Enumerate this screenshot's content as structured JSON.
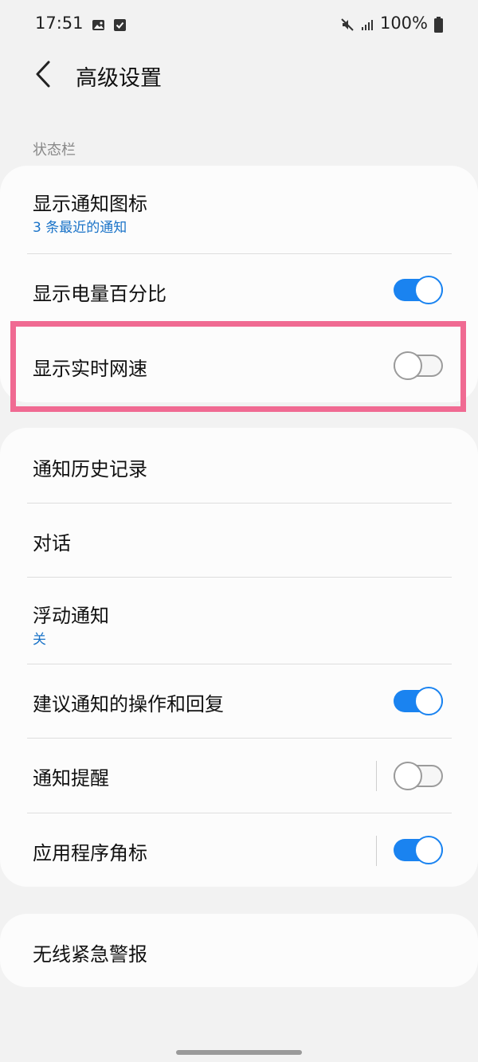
{
  "status_bar": {
    "time": "17:51",
    "battery": "100%",
    "icons": [
      "image-icon",
      "check-box-icon",
      "mute-icon",
      "signal-icon",
      "battery-icon"
    ]
  },
  "header": {
    "back_icon": "chevron-left-icon",
    "title": "高级设置"
  },
  "section": {
    "label": "状态栏"
  },
  "card1": {
    "rows": [
      {
        "title": "显示通知图标",
        "subtitle": "3 条最近的通知"
      },
      {
        "title": "显示电量百分比",
        "toggle": "on"
      },
      {
        "title": "显示实时网速",
        "toggle": "off"
      }
    ]
  },
  "card2": {
    "rows": [
      {
        "title": "通知历史记录"
      },
      {
        "title": "对话"
      },
      {
        "title": "浮动通知",
        "subtitle": "关"
      },
      {
        "title": "建议通知的操作和回复",
        "toggle": "on"
      },
      {
        "title": "通知提醒",
        "toggle": "off"
      },
      {
        "title": "应用程序角标",
        "toggle": "on"
      }
    ]
  },
  "card3": {
    "rows": [
      {
        "title": "无线紧急警报"
      }
    ]
  },
  "colors": {
    "accent": "#1a83f0",
    "subtitle": "#1a73c8",
    "highlight": "#f06a92",
    "background": "#f2f2f2",
    "card": "#fcfcfc"
  }
}
